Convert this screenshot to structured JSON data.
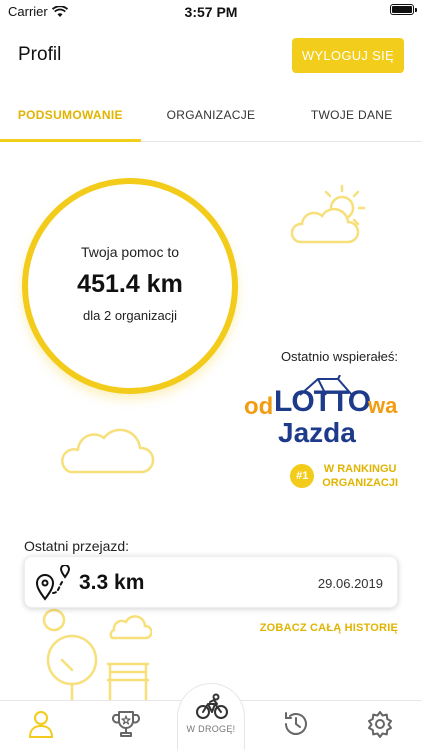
{
  "status_bar": {
    "carrier": "Carrier",
    "time": "3:57 PM"
  },
  "header": {
    "title": "Profil",
    "logout_label": "WYLOGUJ SIĘ"
  },
  "tabs": [
    {
      "label": "PODSUMOWANIE",
      "active": true
    },
    {
      "label": "ORGANIZACJE",
      "active": false
    },
    {
      "label": "TWOJE DANE",
      "active": false
    }
  ],
  "summary": {
    "label": "Twoja pomoc to",
    "value": "451.4 km",
    "sub": "dla 2 organizacji"
  },
  "last_supported": {
    "label": "Ostatnio wspierałeś:",
    "org_logo": {
      "part1": "od",
      "part2": "LOTTO",
      "part3": "wa",
      "part4": "Jazda"
    },
    "rank_badge": "#1",
    "rank_line1": "W RANKINGU",
    "rank_line2": "ORGANIZACJI"
  },
  "last_ride": {
    "label": "Ostatni przejazd:",
    "distance": "3.3 km",
    "date": "29.06.2019",
    "history_link": "ZOBACZ CAŁĄ HISTORIĘ"
  },
  "bottom_nav": {
    "go_label": "W DROGĘ!",
    "items": [
      "profile-icon",
      "trophy-icon",
      "bike-icon",
      "history-icon",
      "settings-icon"
    ]
  },
  "colors": {
    "accent": "#f3cb1a",
    "accent_text": "#e0b400",
    "logo_blue": "#1e3a8a",
    "logo_orange": "#f39c12"
  }
}
